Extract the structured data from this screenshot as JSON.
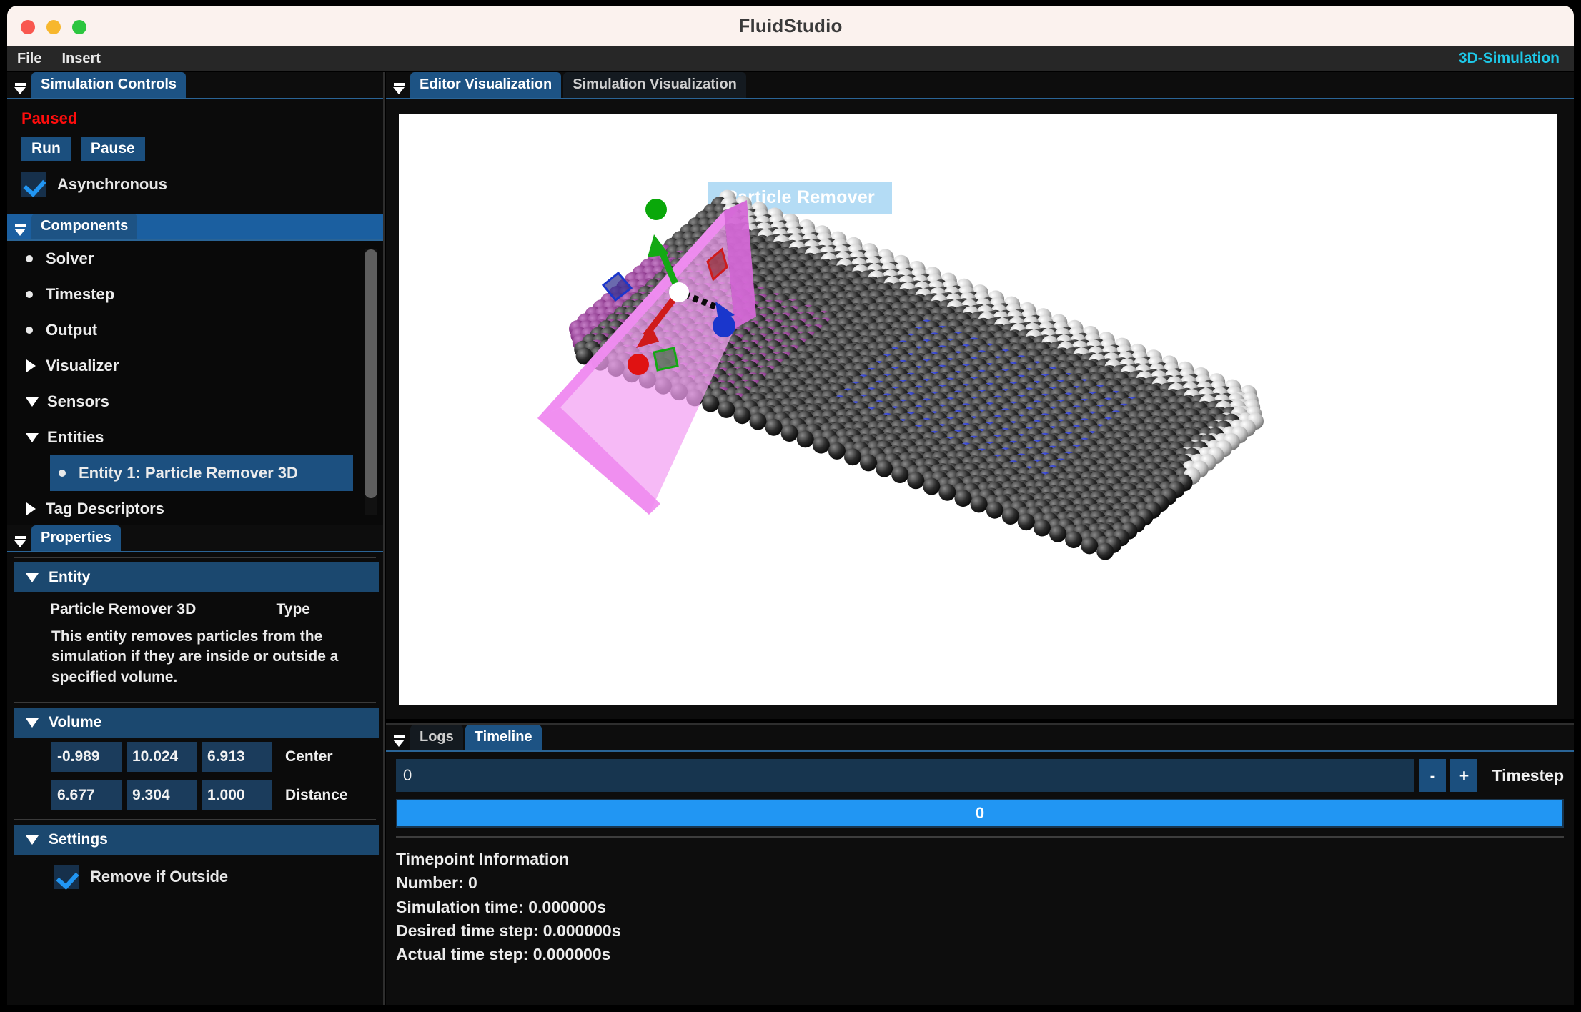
{
  "window": {
    "title": "FluidStudio",
    "traffic_lights": [
      "close",
      "minimize",
      "maximize"
    ]
  },
  "menubar": {
    "items": [
      "File",
      "Insert"
    ],
    "mode_label": "3D-Simulation"
  },
  "left_dock": {
    "sim_controls": {
      "tab_label": "Simulation Controls",
      "status": "Paused",
      "run_label": "Run",
      "pause_label": "Pause",
      "async_label": "Asynchronous",
      "async_checked": true
    },
    "components": {
      "tab_label": "Components",
      "items": [
        {
          "label": "Solver",
          "marker": "bullet",
          "indent": 0,
          "selected": false
        },
        {
          "label": "Timestep",
          "marker": "bullet",
          "indent": 0,
          "selected": false
        },
        {
          "label": "Output",
          "marker": "bullet",
          "indent": 0,
          "selected": false
        },
        {
          "label": "Visualizer",
          "marker": "caret-right",
          "indent": 0,
          "selected": false
        },
        {
          "label": "Sensors",
          "marker": "caret-down",
          "indent": 0,
          "selected": false
        },
        {
          "label": "Entities",
          "marker": "caret-down",
          "indent": 0,
          "selected": false
        },
        {
          "label": "Entity 1: Particle Remover 3D",
          "marker": "bullet",
          "indent": 1,
          "selected": true
        },
        {
          "label": "Tag Descriptors",
          "marker": "caret-right",
          "indent": 0,
          "selected": false
        }
      ]
    },
    "properties": {
      "tab_label": "Properties",
      "entity": {
        "header": "Entity",
        "type_value": "Particle Remover 3D",
        "type_label": "Type",
        "description": "This entity removes particles from the simulation if they are inside or outside a specified volume."
      },
      "volume": {
        "header": "Volume",
        "center": {
          "x": "-0.989",
          "y": "10.024",
          "z": "6.913",
          "label": "Center"
        },
        "distance": {
          "x": "6.677",
          "y": "9.304",
          "z": "1.000",
          "label": "Distance"
        }
      },
      "settings": {
        "header": "Settings",
        "remove_if_outside_label": "Remove if Outside",
        "remove_if_outside_checked": true
      }
    }
  },
  "viz_dock": {
    "tabs": [
      {
        "label": "Editor Visualization",
        "active": true
      },
      {
        "label": "Simulation Visualization",
        "active": false
      }
    ],
    "scene": {
      "badge_label": "Particle Remover",
      "badge_bg": "#b4dcf5",
      "background": "#ffffff",
      "gizmo": {
        "axis_colors": {
          "x": "#cf1b1b",
          "y": "#13a913",
          "z": "#1a36cc"
        },
        "center_handle_color": "#ffffff"
      },
      "particle_colors": {
        "inside_volume": "#8e3a8e",
        "field_dark": "#1c1c1c",
        "field_blue": "#2433c4",
        "field_light": "#d4d4d4"
      },
      "volume_box_color": "#ef8bf0"
    }
  },
  "bottom_dock": {
    "tabs": [
      {
        "label": "Logs",
        "active": false
      },
      {
        "label": "Timeline",
        "active": true
      }
    ],
    "timestep_value": "0",
    "decrement_label": "-",
    "increment_label": "+",
    "timestep_label": "Timestep",
    "slider_value": "0",
    "timepoint_info": {
      "heading": "Timepoint Information",
      "lines": [
        "Number: 0",
        "Simulation time: 0.000000s",
        "Desired time step: 0.000000s",
        "Actual time step: 0.000000s"
      ]
    }
  }
}
